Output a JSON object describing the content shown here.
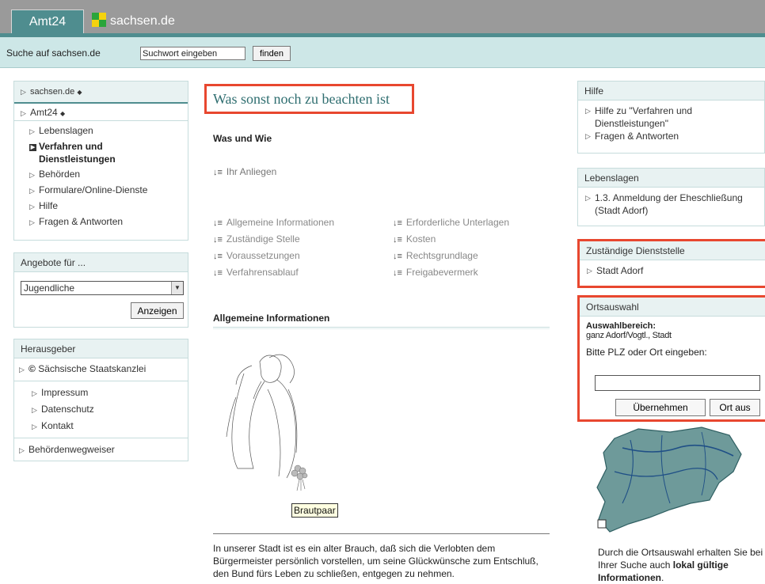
{
  "header": {
    "tab_amt24": "Amt24",
    "tab_sachsen": "sachsen.de"
  },
  "search": {
    "label": "Suche auf sachsen.de",
    "value": "Suchwort eingeben",
    "button": "finden"
  },
  "left_nav": {
    "breadcrumb": "sachsen.de",
    "section": "Amt24",
    "items": [
      {
        "label": "Lebenslagen"
      },
      {
        "label": "Verfahren und Dienstleistungen"
      },
      {
        "label": "Behörden"
      },
      {
        "label": "Formulare/Online-Dienste"
      },
      {
        "label": "Hilfe"
      },
      {
        "label": "Fragen & Antworten"
      }
    ]
  },
  "angebote": {
    "title": "Angebote für ...",
    "selected": "Jugendliche",
    "button": "Anzeigen"
  },
  "herausgeber": {
    "title": "Herausgeber",
    "publisher": "Sächsische Staatskanzlei",
    "links": [
      "Impressum",
      "Datenschutz",
      "Kontakt"
    ],
    "wegweiser": "Behördenwegweiser"
  },
  "main": {
    "title": "Was sonst noch zu beachten ist",
    "section_was": "Was und Wie",
    "anliegen": "Ihr Anliegen",
    "links_left": [
      "Allgemeine Informationen",
      "Zuständige Stelle",
      "Voraussetzungen",
      "Verfahrensablauf"
    ],
    "links_right": [
      "Erforderliche Unterlagen",
      "Kosten",
      "Rechtsgrundlage",
      "Freigabevermerk"
    ],
    "section_allg": "Allgemeine Informationen",
    "image_caption": "Brautpaar",
    "paragraph": "In unserer Stadt ist es ein alter Brauch, daß sich die Verlobten dem Bürgermeister persönlich vorstellen, um seine Glückwünsche zum Entschluß, den Bund fürs Leben zu schließen, entgegen zu nehmen."
  },
  "right": {
    "hilfe": {
      "title": "Hilfe",
      "items": [
        "Hilfe zu \"Verfahren und Dienstleistungen\"",
        "Fragen & Antworten"
      ]
    },
    "lebenslagen": {
      "title": "Lebenslagen",
      "items": [
        "1.3. Anmeldung der Eheschließung (Stadt Adorf)"
      ]
    },
    "dienststelle": {
      "title": "Zuständige Dienststelle",
      "items": [
        "Stadt Adorf"
      ]
    },
    "ortsauswahl": {
      "title": "Ortsauswahl",
      "bereich_label": "Auswahlbereich:",
      "bereich_value": "ganz Adorf/Vogtl., Stadt",
      "prompt": "Bitte PLZ oder Ort eingeben:",
      "input_value": "",
      "btn_uebernehmen": "Übernehmen",
      "btn_ortaus": "Ort aus"
    },
    "map_note_pre": "Durch die Ortsauswahl erhalten Sie bei Ihrer Suche auch ",
    "map_note_bold": "lokal gültige Informationen",
    "map_note_post": "."
  },
  "colors": {
    "accent": "#4f8d8f",
    "highlight": "#e8472f",
    "searchbar": "#cde7e7"
  }
}
